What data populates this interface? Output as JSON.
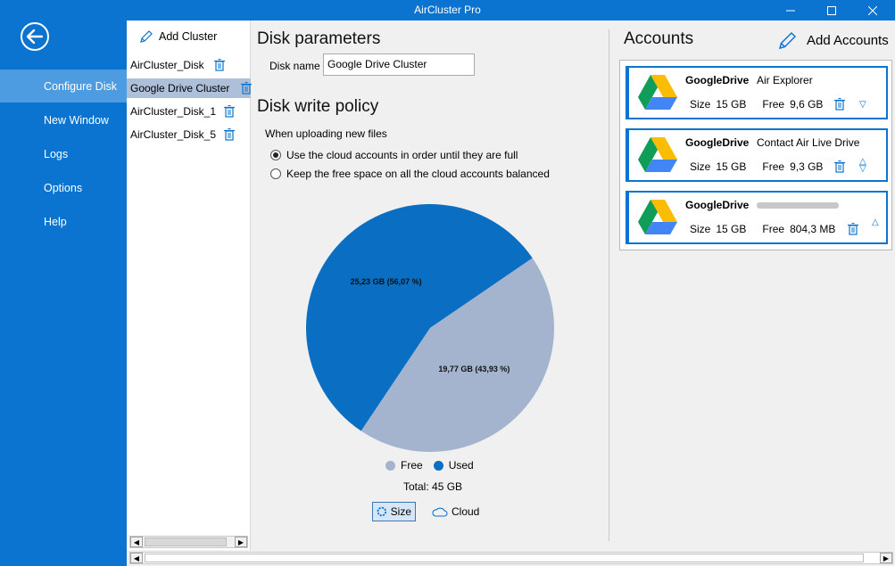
{
  "window": {
    "title": "AirCluster Pro"
  },
  "sidebar": {
    "items": [
      {
        "label": "Configure Disk"
      },
      {
        "label": "New Window"
      },
      {
        "label": "Logs"
      },
      {
        "label": "Options"
      },
      {
        "label": "Help"
      }
    ]
  },
  "clusters": {
    "add_label": "Add Cluster",
    "items": [
      {
        "label": "AirCluster_Disk"
      },
      {
        "label": "Google Drive Cluster"
      },
      {
        "label": "AirCluster_Disk_1"
      },
      {
        "label": "AirCluster_Disk_5"
      }
    ]
  },
  "disk": {
    "params_title": "Disk parameters",
    "name_label": "Disk name",
    "name_value": "Google Drive Cluster",
    "policy_title": "Disk write policy",
    "policy_caption": "When uploading new files",
    "policy_options": [
      {
        "label": "Use the cloud accounts in order until they are full",
        "checked": true
      },
      {
        "label": "Keep the free space on all the cloud accounts balanced",
        "checked": false
      }
    ]
  },
  "chart": {
    "legend_free": "Free",
    "legend_used": "Used",
    "total": "Total: 45 GB",
    "toggle_size": "Size",
    "toggle_cloud": "Cloud",
    "colors": {
      "used": "#0a6fc2",
      "free": "#a4b4cf"
    }
  },
  "chart_data": {
    "type": "pie",
    "slices": [
      {
        "name": "Used",
        "value": 25.23,
        "percent": 56.07,
        "label": "25,23 GB (56,07 %)"
      },
      {
        "name": "Free",
        "value": 19.77,
        "percent": 43.93,
        "label": "19,77 GB (43,93 %)"
      }
    ]
  },
  "accounts": {
    "title": "Accounts",
    "add_label": "Add Accounts",
    "size_label": "Size",
    "free_label": "Free",
    "items": [
      {
        "service": "GoogleDrive",
        "name": "Air Explorer",
        "size": "15 GB",
        "free": "9,6 GB"
      },
      {
        "service": "GoogleDrive",
        "name": "Contact Air Live Drive",
        "size": "15 GB",
        "free": "9,3 GB"
      },
      {
        "service": "GoogleDrive",
        "name": "",
        "size": "15 GB",
        "free": "804,3 MB"
      }
    ]
  }
}
